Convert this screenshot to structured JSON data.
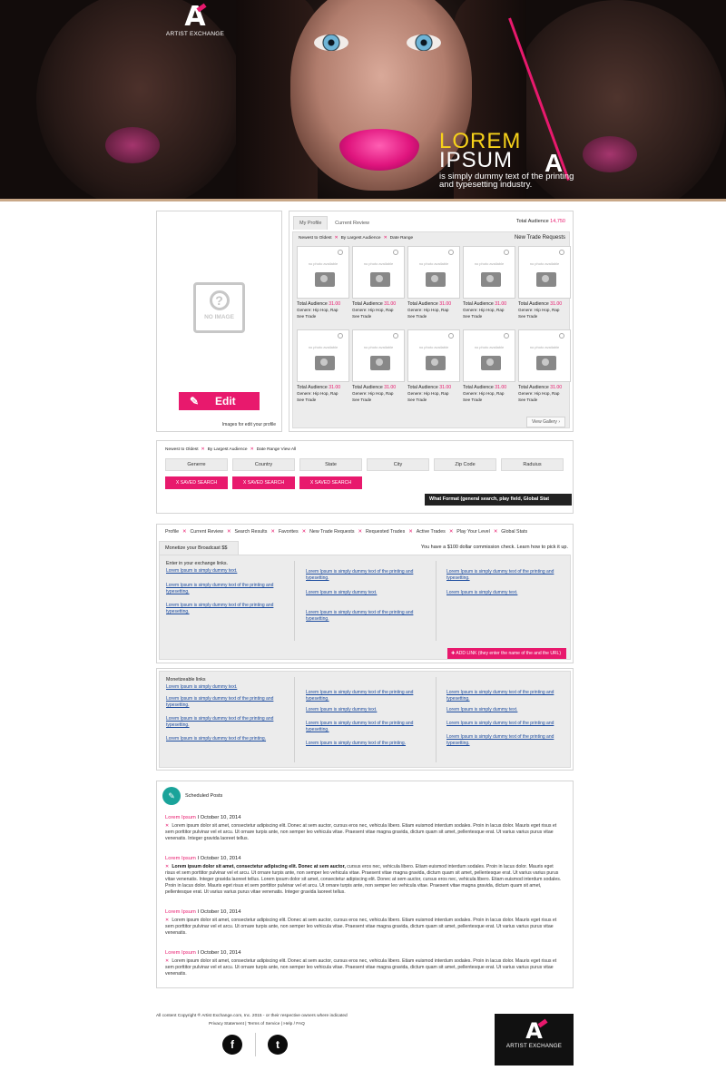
{
  "hero": {
    "logo_letter": "A",
    "logo_text": "ARTIST EXCHANGE",
    "lorem": "LOREM",
    "ipsum": "IPSUM",
    "mark": "A",
    "subtitle": "is simply dummy text of the printing and typesetting industry."
  },
  "profile": {
    "no_image": "NO IMAGE",
    "edit_label": "Edit",
    "caption": "Images for edit your profile"
  },
  "trades": {
    "tabs": [
      "My Profile",
      "Current Review"
    ],
    "total_audience_label": "Total Audience",
    "total_audience_value": "14,750",
    "filters": [
      "Newest to Oldest",
      "By Largest Audience",
      "Date Range"
    ],
    "new_trade_requests": "New Trade Requests",
    "no_photo": "no photo available",
    "card_audience_label": "Total Audience",
    "card_audience_value": "31.00",
    "card_genre": "Genere: Hip Hop, Rap",
    "card_see": "See Trade",
    "view_gallery": "View Gallery"
  },
  "search": {
    "filters": [
      "Newest to Oldest",
      "By Largest Audience",
      "Date Range View All"
    ],
    "fields": [
      "Generre",
      "Country",
      "State",
      "City",
      "Zip Code",
      "Raduius"
    ],
    "saved_label": "X  SAVED SEARCH",
    "what_format": "What Format (general search, play field, Global Stat"
  },
  "nav": {
    "items": [
      "Profile",
      "Current Review",
      "Search Results",
      "Favorites",
      "New Trade Requests",
      "Requested Trades",
      "Active Trades",
      "Play Your Level",
      "Global Stats"
    ],
    "monetize_tab": "Monetize your Broadcast $$",
    "commission": "You have a $100 dollar commission check. Learn how to pick it up.",
    "enter_label": "Enter in your exchange links.",
    "col1": [
      "Lorem Ipsum is simply dummy text.",
      "Lorem Ipsum is simply dummy text of the printing and typesetting.",
      "Lorem Ipsum is simply dummy text of the printing and typesetting."
    ],
    "col2": [
      "Lorem Ipsum is simply dummy text of the printing and typesetting.",
      "Lorem Ipsum is simply dummy text.",
      "Lorem Ipsum is simply dummy text of the printing and typesetting."
    ],
    "col3": [
      "Lorem Ipsum is simply dummy text of the printing and typesetting.",
      "Lorem Ipsum is simply dummy text."
    ],
    "add_link": "ADD LINK (they enter the name of the and the URL)"
  },
  "monetizeable": {
    "title": "Monetizeable links",
    "col1": [
      "Lorem Ipsum is simply dummy text.",
      "Lorem Ipsum is simply dummy text of the printing and typesetting.",
      "Lorem Ipsum is simply dummy text of the printing and typesetting.",
      "Lorem Ipsum is simply dummy text of the printing."
    ],
    "col2": [
      "Lorem Ipsum is simply dummy text of the printing and typesetting.",
      "Lorem Ipsum is simply dummy text.",
      "Lorem Ipsum is simply dummy text of the printing and typesetting.",
      "Lorem Ipsum is simply dummy text of the printing."
    ],
    "col3": [
      "Lorem Ipsum is simply dummy text of the printing and typesetting.",
      "Lorem Ipsum is simply dummy text.",
      "Lorem Ipsum is simply dummy text of the printing and",
      "Lorem Ipsum is simply dummy text of the printing and typesetting."
    ]
  },
  "scheduled": {
    "title": "Scheduled Posts",
    "posts": [
      {
        "name": "Lorem Ipsum",
        "date": "I October 10, 2014",
        "bold": "",
        "body": "Lorem ipsum dolor sit amet, consectetur adipiscing elit. Donec at sem auctor, cursus eros nec, vehicula libero. Etiam euismod interdum sodales. Proin in lacus dolor. Mauris eget risus et sem porttitor pulvinar vel et arcu. Ut ornare turpis ante, non semper leo vehicula vitae. Praesent vitae magna gravida, dictum quam sit amet, pellentesque erat. Ut varius varius purus vitae venenatis. Integer gravida laoreet tellus."
      },
      {
        "name": "Lorem Ipsum",
        "date": "I October 10, 2014",
        "bold": "Lorem ipsum dolor sit amet, consectetur adipiscing elit. Donec at sem auctor,",
        "body": " cursus eros nec, vehicula libero. Etiam euismod interdum sodales. Proin in lacus dolor. Mauris eget risus et sem porttitor pulvinar vel et arcu. Ut ornare turpis ante, non semper leo vehicula vitae. Praesent vitae magna gravida, dictum quam sit amet, pellentesque erat. Ut varius varius purus vitae venenatis. Integer gravida laoreet tellus. Lorem ipsum dolor sit amet, consectetur adipiscing elit. Donec at sem auctor, cursus eros nec, vehicula libero. Etiam euismod interdum sodales. Proin in lacus dolor. Mauris eget risus et sem porttitor pulvinar vel et arcu. Ut ornare turpis ante, non semper leo vehicula vitae. Praesent vitae magna gravida, dictum quam sit amet, pellentesque erat. Ut varius varius purus vitae venenatis. Integer gravida laoreet tellus."
      },
      {
        "name": "Lorem Ipsum",
        "date": "I October 10, 2014",
        "bold": "",
        "body": "Lorem ipsum dolor sit amet, consectetur adipiscing elit. Donec at sem auctor, cursus eros nec, vehicula libero. Etiam euismod interdum sodales. Proin in lacus dolor. Mauris eget risus et sem porttitor pulvinar vel et arcu. Ut ornare turpis ante, non semper leo vehicula vitae. Praesent vitae magna gravida, dictum quam sit amet, pellentesque erat. Ut varius varius purus vitae venenatis."
      },
      {
        "name": "Lorem Ipsum",
        "date": "I October 10, 2014",
        "bold": "",
        "body": "Lorem ipsum dolor sit amet, consectetur adipiscing elit. Donec at sem auctor, cursus eros nec, vehicula libero. Etiam euismod interdum sodales. Proin in lacus dolor. Mauris eget risus et sem porttitor pulvinar vel et arcu. Ut ornare turpis ante, non semper leo vehicula vitae. Praesent vitae magna gravida, dictum quam sit amet, pellentesque erat. Ut varius varius purus vitae venenatis."
      }
    ]
  },
  "footer": {
    "copyright": "All content Copyright ® Artist Exchange.com, Inc. 2015 - or their respective owners where indicated",
    "links": "Privacy Statement | Terms of Service | Help / FAQ",
    "facebook": "f",
    "twitter": "t",
    "logo_letter": "A",
    "logo_text": "ARTIST EXCHANGE"
  }
}
